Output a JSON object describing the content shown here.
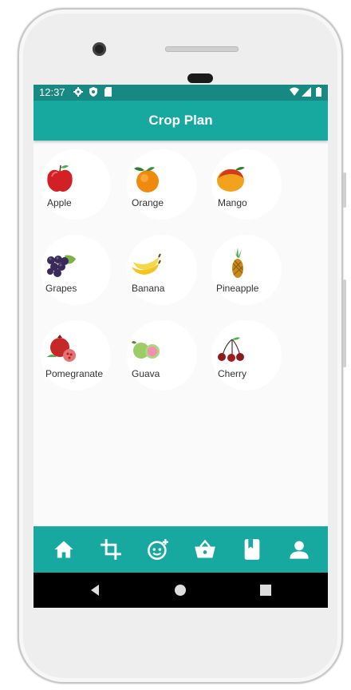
{
  "status_bar": {
    "time": "12:37"
  },
  "app_bar": {
    "title": "Crop Plan"
  },
  "crops": [
    {
      "name": "Apple",
      "icon": "apple-icon"
    },
    {
      "name": "Orange",
      "icon": "orange-icon"
    },
    {
      "name": "Mango",
      "icon": "mango-icon"
    },
    {
      "name": "Grapes",
      "icon": "grapes-icon"
    },
    {
      "name": "Banana",
      "icon": "banana-icon"
    },
    {
      "name": "Pineapple",
      "icon": "pineapple-icon"
    },
    {
      "name": "Pomegranate",
      "icon": "pomegranate-icon"
    },
    {
      "name": "Guava",
      "icon": "guava-icon"
    },
    {
      "name": "Cherry",
      "icon": "cherry-icon"
    }
  ],
  "bottom_nav": [
    {
      "icon": "home-icon"
    },
    {
      "icon": "crop-icon"
    },
    {
      "icon": "plant-doctor-icon"
    },
    {
      "icon": "basket-icon"
    },
    {
      "icon": "book-icon"
    },
    {
      "icon": "profile-icon"
    }
  ],
  "colors": {
    "primary": "#17a8a0",
    "status_bar": "#168a82",
    "background": "#fafafa"
  }
}
